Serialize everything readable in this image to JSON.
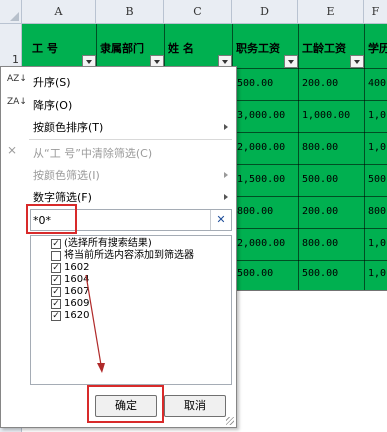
{
  "columns": [
    "A",
    "B",
    "C",
    "D",
    "E",
    "F"
  ],
  "row_number": "1",
  "headers": {
    "a": "工 号",
    "b": "隶属部门",
    "c": "姓 名",
    "d": "职务工资",
    "e": "工龄工资",
    "f": "学历"
  },
  "rows": [
    {
      "d": "500.00",
      "e": "200.00",
      "f": "400"
    },
    {
      "d": "3,000.00",
      "e": "1,000.00",
      "f": "1,0"
    },
    {
      "d": "2,000.00",
      "e": "800.00",
      "f": "1,0"
    },
    {
      "d": "1,500.00",
      "e": "500.00",
      "f": "500"
    },
    {
      "d": "800.00",
      "e": "200.00",
      "f": "800"
    },
    {
      "d": "2,000.00",
      "e": "800.00",
      "f": "1,0"
    },
    {
      "d": "500.00",
      "e": "500.00",
      "f": "1,0"
    }
  ],
  "menu": {
    "sort_asc": "升序(S)",
    "sort_desc": "降序(O)",
    "sort_by_color": "按颜色排序(T)",
    "clear_filter": "从“工 号”中清除筛选(C)",
    "filter_by_color": "按颜色筛选(I)",
    "number_filter": "数字筛选(F)",
    "sort_asc_icon": "AZ↓",
    "sort_desc_icon": "ZA↓"
  },
  "search": {
    "value": "*0*"
  },
  "list": [
    {
      "label": "(选择所有搜索结果)",
      "checked": true
    },
    {
      "label": "将当前所选内容添加到筛选器",
      "checked": false
    },
    {
      "label": "1602",
      "checked": true
    },
    {
      "label": "1604",
      "checked": true
    },
    {
      "label": "1607",
      "checked": true
    },
    {
      "label": "1609",
      "checked": true
    },
    {
      "label": "1620",
      "checked": true
    }
  ],
  "buttons": {
    "ok": "确定",
    "cancel": "取消"
  },
  "colors": {
    "header_fill": "#00b050",
    "highlight": "#d82a2a"
  }
}
